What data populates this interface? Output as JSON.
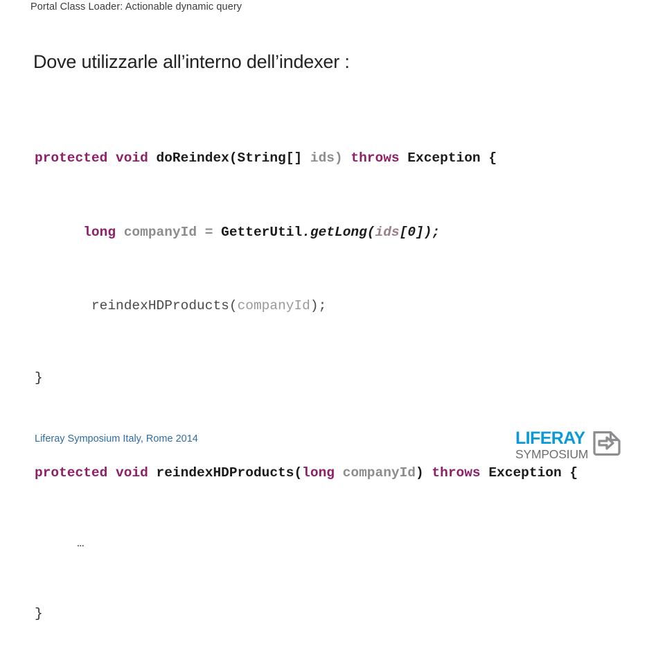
{
  "slide": {
    "header": "Portal Class Loader: Actionable dynamic query",
    "title": "Dove utilizzarle all’interno dell’indexer :"
  },
  "code": {
    "language": "java",
    "lines": [
      {
        "id": "line-1",
        "text": "protected void doReindex(String[] ids) throws Exception {",
        "tokens": [
          {
            "t": "protected void ",
            "k": "keyword"
          },
          {
            "t": "doReindex(String[] ",
            "k": "function"
          },
          {
            "t": "ids)",
            "k": "variable"
          },
          {
            "t": " ",
            "k": "plain"
          },
          {
            "t": "throws",
            "k": "keyword"
          },
          {
            "t": " Exception {",
            "k": "plain"
          }
        ]
      },
      {
        "id": "line-2",
        "text": "    long companyId = GetterUtil.getLong(ids[0]);",
        "tokens": [
          {
            "t": "      ",
            "k": "plain"
          },
          {
            "t": "long",
            "k": "keyword"
          },
          {
            "t": " companyId = ",
            "k": "variable"
          },
          {
            "t": "GetterUtil",
            "k": "plain"
          },
          {
            "t": ".getLong(",
            "k": "italic"
          },
          {
            "t": "ids",
            "k": "italic-variable"
          },
          {
            "t": "[0]);",
            "k": "italic"
          }
        ]
      },
      {
        "id": "line-3",
        "text": "    reindexHDProducts(companyId);",
        "tokens": [
          {
            "t": "       ",
            "k": "plain"
          },
          {
            "t": "reindexHDProducts(",
            "k": "call"
          },
          {
            "t": "companyId",
            "k": "argument"
          },
          {
            "t": ");",
            "k": "call"
          }
        ]
      },
      {
        "id": "line-4",
        "text": "}",
        "tokens": [
          {
            "t": "}",
            "k": "brace"
          }
        ]
      },
      {
        "id": "line-5",
        "text": "protected void reindexHDProducts(long companyId) throws Exception {",
        "tokens": [
          {
            "t": "protected void ",
            "k": "keyword"
          },
          {
            "t": "reindexHDProducts(",
            "k": "function"
          },
          {
            "t": "long",
            "k": "keyword"
          },
          {
            "t": " companyId",
            "k": "variable"
          },
          {
            "t": ")",
            "k": "plain"
          },
          {
            "t": " ",
            "k": "plain"
          },
          {
            "t": "throws",
            "k": "keyword"
          },
          {
            "t": " Exception {",
            "k": "plain"
          }
        ]
      },
      {
        "id": "line-6",
        "text": "    …",
        "tokens": [
          {
            "t": "      …",
            "k": "brace"
          }
        ]
      },
      {
        "id": "line-7",
        "text": "}",
        "tokens": [
          {
            "t": "}",
            "k": "brace"
          }
        ]
      }
    ]
  },
  "footer": {
    "credit": "Liferay Symposium Italy, Rome 2014",
    "logo": {
      "primary": "LIFERAY",
      "secondary": "SYMPOSIUM",
      "mark": "document-arrow-icon"
    }
  },
  "colors": {
    "background": "#ffffff",
    "header_text": "#3b3b3b",
    "title_text": "#222222",
    "keyword": "#8e1f69",
    "identifier": "#1b1b1b",
    "variable": "#8d8d8d",
    "italic_variable": "#9c8087",
    "call": "#4a4a4a",
    "footer_link": "#2e6da4",
    "logo_blue": "#0b9ad7",
    "logo_gray": "#6d6e71"
  }
}
